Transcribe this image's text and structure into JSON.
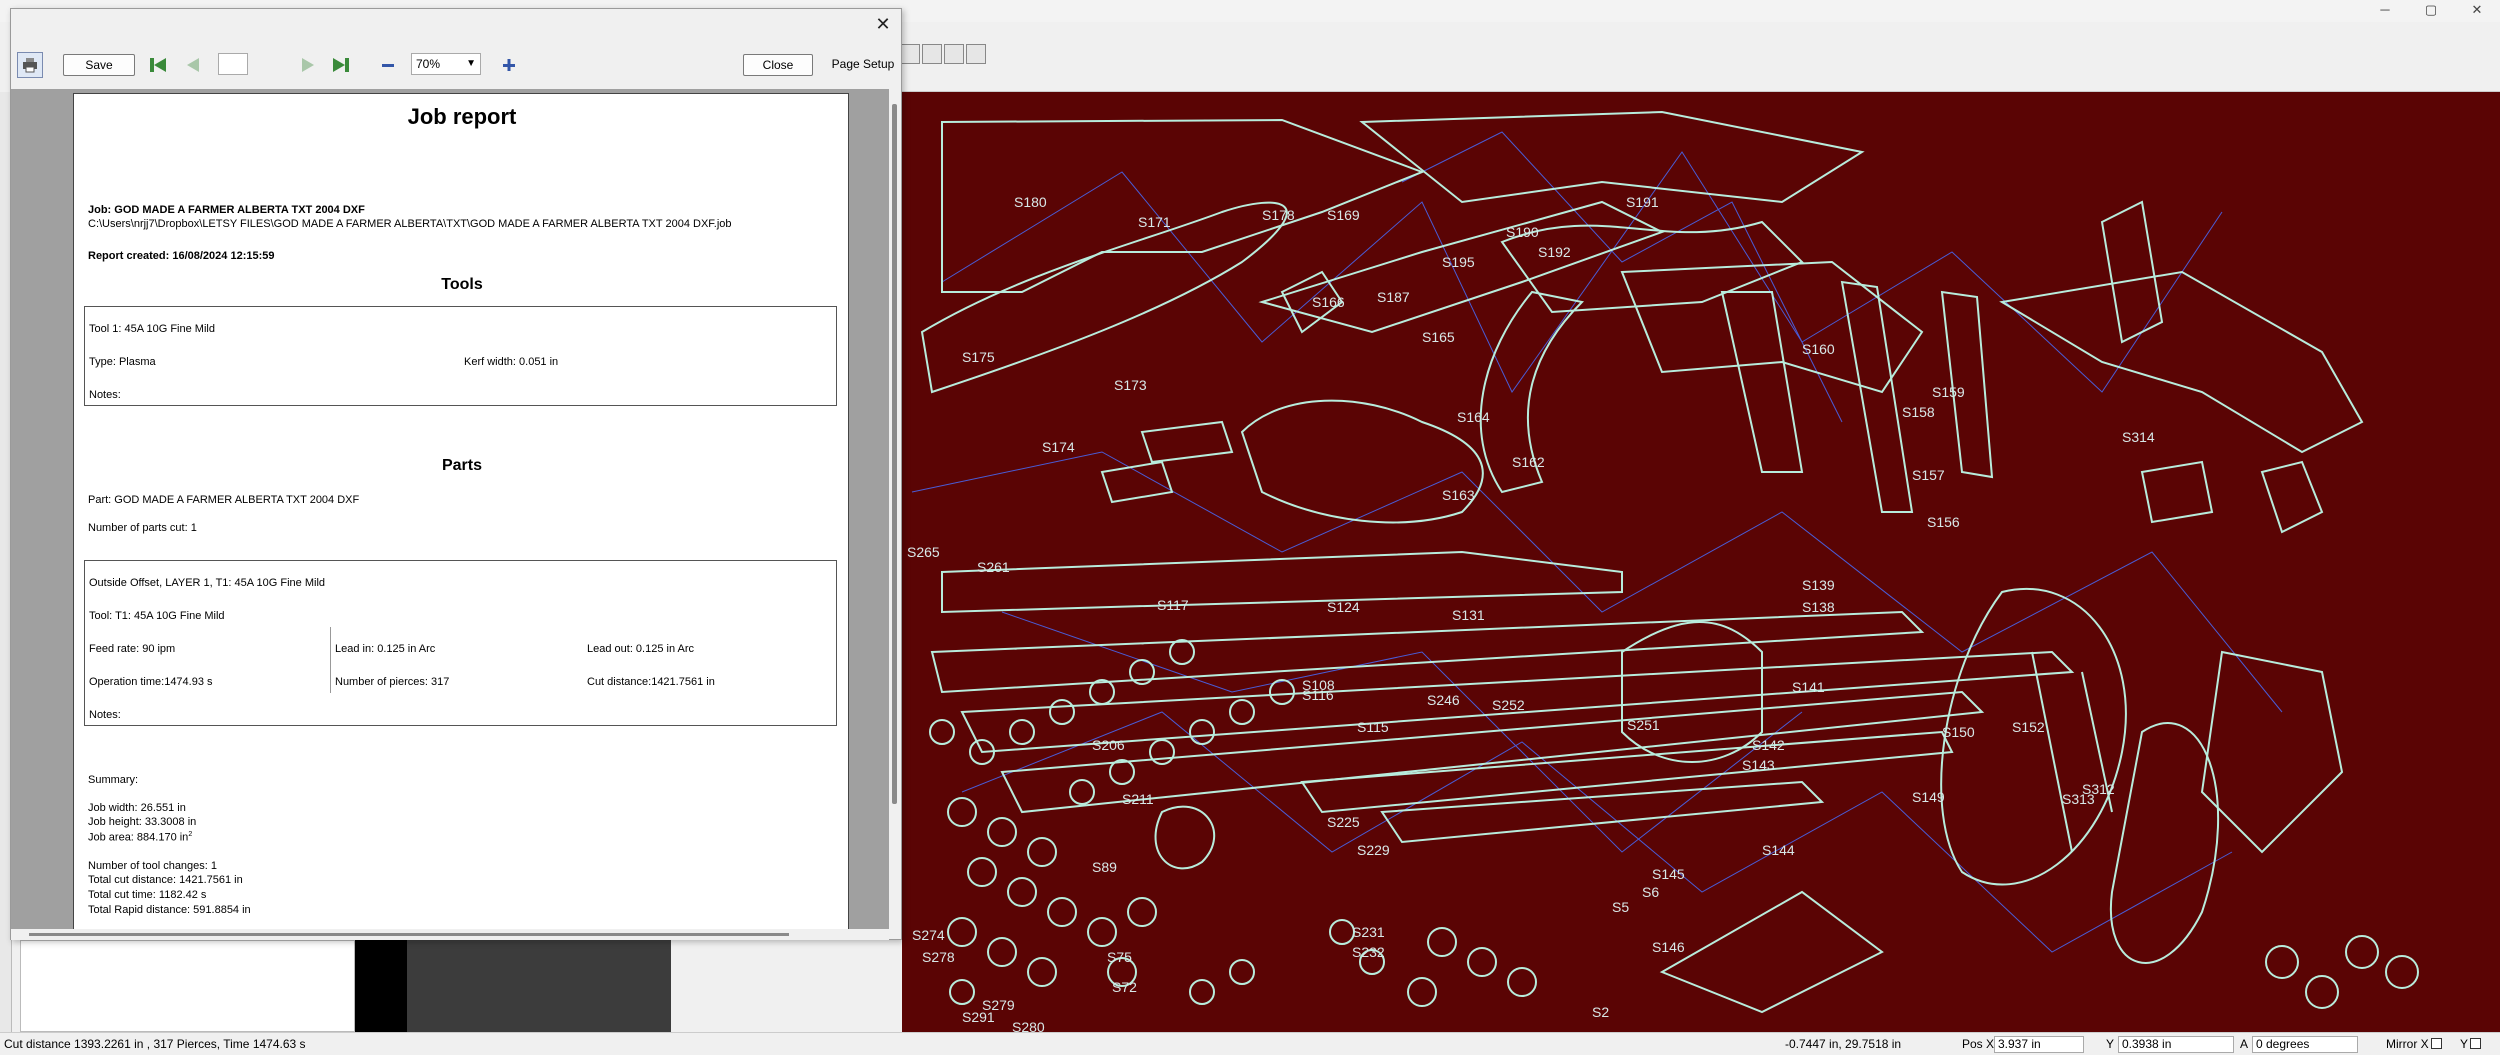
{
  "dialog": {
    "close_glyph": "✕",
    "toolbar": {
      "save_label": "Save",
      "page_value": "",
      "zoom_value": "70%",
      "close_label": "Close",
      "page_setup_label": "Page Setup"
    }
  },
  "report": {
    "title": "Job report",
    "job_line": "Job: GOD MADE A FARMER ALBERTA TXT 2004 DXF",
    "job_path": "C:\\Users\\nrjj7\\Dropbox\\LETSY FILES\\GOD MADE A FARMER ALBERTA\\TXT\\GOD MADE A FARMER ALBERTA TXT 2004 DXF.job",
    "created": "Report created: 16/08/2024 12:15:59",
    "tools_heading": "Tools",
    "tool": {
      "name": "Tool 1: 45A 10G Fine Mild",
      "type": "Type: Plasma",
      "kerf": "Kerf width: 0.051 in",
      "notes": "Notes:"
    },
    "parts_heading": "Parts",
    "part_line": "Part: GOD MADE A FARMER ALBERTA TXT 2004 DXF",
    "parts_cut": "Number of parts cut: 1",
    "op": {
      "title": "Outside Offset, LAYER 1, T1: 45A 10G Fine Mild",
      "tool": "Tool: T1: 45A 10G Fine Mild",
      "feed": "Feed rate: 90 ipm",
      "lead_in": "Lead in: 0.125 in Arc",
      "lead_out": "Lead out: 0.125 in Arc",
      "op_time": "Operation time:1474.93 s",
      "pierces": "Number of pierces: 317",
      "cut_dist": "Cut distance:1421.7561 in",
      "notes": "Notes:"
    },
    "summary": {
      "heading": "Summary:",
      "width": "Job width: 26.551 in",
      "height": "Job height: 33.3008 in",
      "area": "Job area: 884.170 in",
      "area_sup": "2",
      "tool_changes": "Number of tool changes: 1",
      "total_cut": "Total cut distance: 1421.7561 in",
      "cut_time": "Total cut time: 1182.42 s",
      "rapid": "Total Rapid distance: 591.8854 in"
    }
  },
  "canvas": {
    "part_labels": [
      "S180",
      "S178",
      "S169",
      "S171",
      "S191",
      "S190",
      "S192",
      "S195",
      "S187",
      "S166",
      "S165",
      "S175",
      "S173",
      "S160",
      "S159",
      "S158",
      "S314",
      "S164",
      "S162",
      "S163",
      "S174",
      "S157",
      "S156",
      "S139",
      "S138",
      "S131",
      "S124",
      "S117",
      "S116",
      "S115",
      "S108",
      "S141",
      "S142",
      "S143",
      "S144",
      "S145",
      "S146",
      "S206",
      "S211",
      "S225",
      "S229",
      "S231",
      "S232",
      "S246",
      "S251",
      "S252",
      "S261",
      "S265",
      "S274",
      "S278",
      "S279",
      "S280",
      "S291",
      "S312",
      "S313",
      "S152",
      "S150",
      "S149",
      "S2",
      "S5",
      "S6",
      "S72",
      "S75",
      "S89"
    ]
  },
  "status": {
    "left": "Cut distance 1393.2261 in , 317 Pierces, Time 1474.63 s",
    "coords": "-0.7447 in, 29.7518 in",
    "pos_x_label": "Pos X",
    "pos_x_value": "3.937 in",
    "y_label": "Y",
    "y_value": "0.3938 in",
    "a_label": "A",
    "a_value": "0 degrees",
    "mirror_x_label": "Mirror X",
    "mirror_y_label": "Y"
  },
  "colors": {
    "canvas_bg": "#5a0404",
    "cut_path": "#b8ecdc",
    "rapid_path": "#4a5cd6"
  }
}
